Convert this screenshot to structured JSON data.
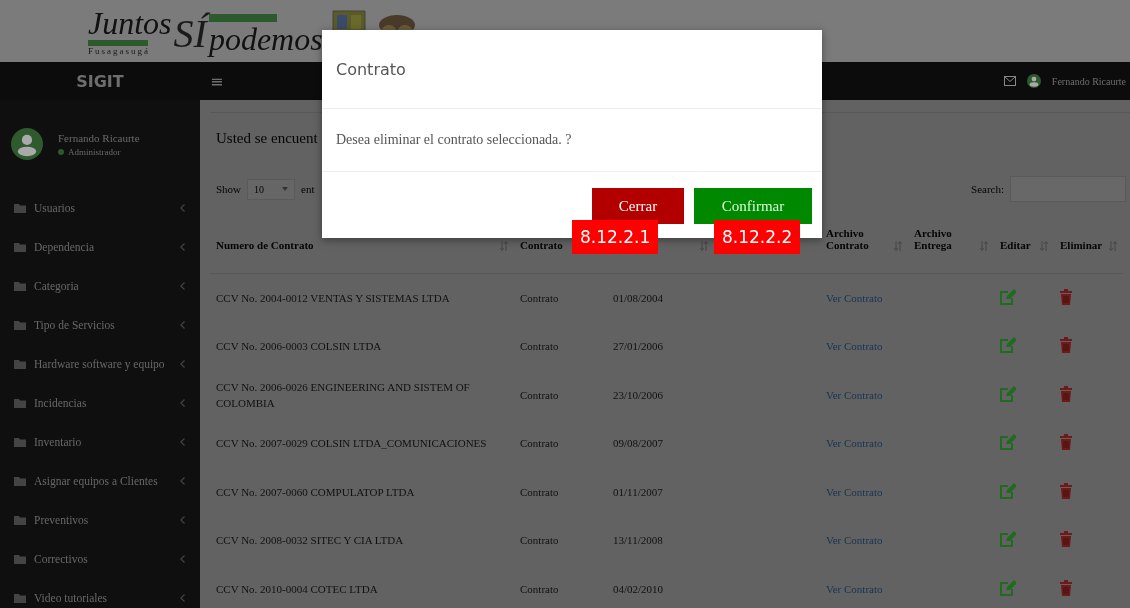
{
  "logo": {
    "word_left": "Juntos",
    "word_mark": "SÍ",
    "word_right": "podemos",
    "town": "Fusagasugá"
  },
  "brand": "SIGIT",
  "navbar": {
    "menu_glyph": "≡",
    "user": "Fernando Ricaurte"
  },
  "user_panel": {
    "name": "Fernando Ricaurte",
    "role": "Administrador"
  },
  "sidebar": {
    "items": [
      {
        "label": "Usuarios"
      },
      {
        "label": "Dependencia"
      },
      {
        "label": "Categoria"
      },
      {
        "label": "Tipo de Servicios"
      },
      {
        "label": "Hardware software y equipo"
      },
      {
        "label": "Incidencias"
      },
      {
        "label": "Inventario"
      },
      {
        "label": "Asignar equipos a Clientes"
      },
      {
        "label": "Preventivos"
      },
      {
        "label": "Correctivos"
      },
      {
        "label": "Video tutoriales"
      }
    ]
  },
  "content": {
    "heading": "Usted se encuent",
    "length_label": "Show",
    "length_value": "10",
    "length_suffix": "ent",
    "search_label": "Search:"
  },
  "table": {
    "columns": [
      {
        "label": "Numero de Contrato"
      },
      {
        "label": "Contrato"
      },
      {},
      {},
      {
        "label": "Archivo Contrato"
      },
      {
        "label": "Archivo Entrega"
      },
      {
        "label": "Editar"
      },
      {
        "label": "Eliminar"
      }
    ],
    "rows": [
      {
        "number": "CCV No. 2004-0012 VENTAS Y SISTEMAS LTDA",
        "type": "Contrato",
        "date": "01/08/2004",
        "file_link": "Ver Contrato"
      },
      {
        "number": "CCV No. 2006-0003 COLSIN LTDA",
        "type": "Contrato",
        "date": "27/01/2006",
        "file_link": "Ver Contrato"
      },
      {
        "number": "CCV No. 2006-0026 ENGINEERING AND SISTEM OF COLOMBIA",
        "type": "Contrato",
        "date": "23/10/2006",
        "file_link": "Ver Contrato"
      },
      {
        "number": "CCV No. 2007-0029 COLSIN LTDA_COMUNICACIONES",
        "type": "Contrato",
        "date": "09/08/2007",
        "file_link": "Ver Contrato"
      },
      {
        "number": "CCV No. 2007-0060 COMPULATOP LTDA",
        "type": "Contrato",
        "date": "01/11/2007",
        "file_link": "Ver Contrato"
      },
      {
        "number": "CCV No. 2008-0032 SITEC Y CIA LTDA",
        "type": "Contrato",
        "date": "13/11/2008",
        "file_link": "Ver Contrato"
      },
      {
        "number": "CCV No. 2010-0004 COTEC LTDA",
        "type": "Contrato",
        "date": "04/02/2010",
        "file_link": "Ver Contrato"
      }
    ]
  },
  "modal": {
    "title": "Contrato",
    "message": "Desea eliminar el contrato seleccionada. ?",
    "buttons": [
      {
        "label": "Cerrar",
        "kind": "danger",
        "callout": "8.12.2.1"
      },
      {
        "label": "Confirmar",
        "kind": "success",
        "callout": "8.12.2.2"
      }
    ]
  }
}
